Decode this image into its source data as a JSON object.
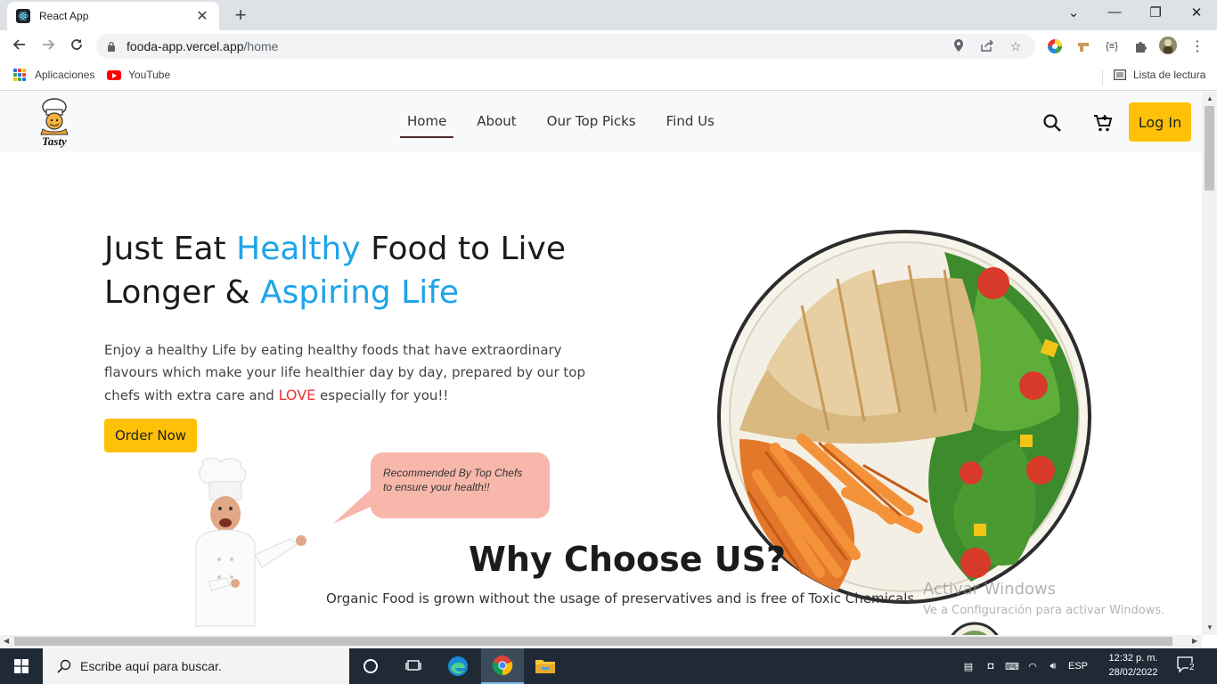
{
  "browser": {
    "tab_title": "React App",
    "url_host": "fooda-app.vercel.app",
    "url_path": "/home",
    "bookmarks": [
      {
        "label": "Aplicaciones"
      },
      {
        "label": "YouTube"
      }
    ],
    "reading_list": "Lista de lectura"
  },
  "site": {
    "nav": [
      "Home",
      "About",
      "Our Top Picks",
      "Find Us"
    ],
    "active_nav": "Home",
    "login": "Log In",
    "hero": {
      "title_1": "Just Eat ",
      "title_hl_1": "Healthy",
      "title_2": " Food to Live Longer & ",
      "title_hl_2": "Aspiring Life",
      "text_1": "Enjoy a healthy Life by eating healthy foods that have extraordinary flavours which make your life healthier day by day, prepared by our top chefs with extra care and ",
      "text_love": "LOVE",
      "text_2": " especially for you!!",
      "order": "Order Now"
    },
    "bubble_line_1": "Recommended By Top Chefs",
    "bubble_line_2": "to ensure your health!!",
    "why_title": "Why Choose US?",
    "why_text": "Organic Food is grown without the usage of preservatives and is free of Toxic Chemicals"
  },
  "watermark": {
    "line_1": "Activar Windows",
    "line_2": "Ve a Configuración para activar Windows."
  },
  "taskbar": {
    "search_placeholder": "Escribe aquí para buscar.",
    "lang": "ESP",
    "time": "12:32 p. m.",
    "date": "28/02/2022",
    "notifications": "2"
  },
  "colors": {
    "accent_yellow": "#ffc107",
    "highlight_blue": "#1ea4e9",
    "love_red": "#e53935",
    "bubble_pink": "#f7b7aa"
  }
}
